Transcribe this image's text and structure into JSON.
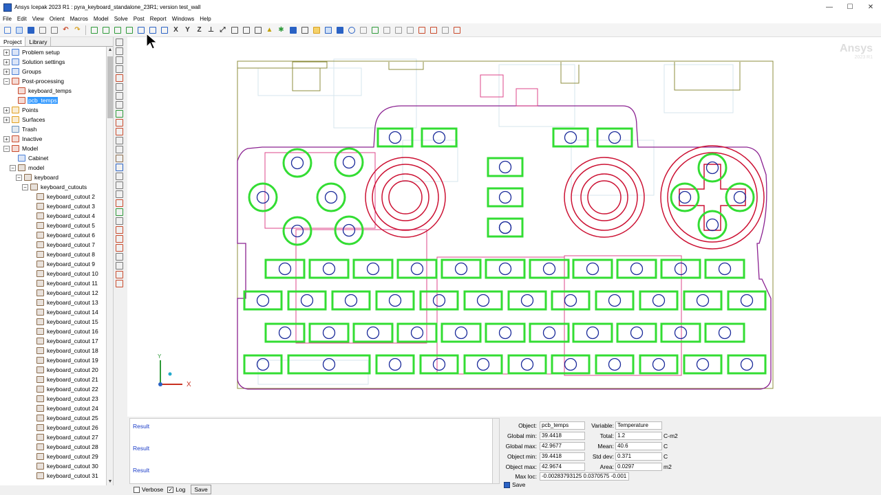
{
  "app": {
    "title": "Ansys Icepak 2023 R1 : pyra_keyboard_standalone_23R1; version test_wall"
  },
  "window_controls": {
    "minimize": "—",
    "maximize": "☐",
    "close": "✕"
  },
  "menu": [
    "File",
    "Edit",
    "View",
    "Orient",
    "Macros",
    "Model",
    "Solve",
    "Post",
    "Report",
    "Windows",
    "Help"
  ],
  "toolbar_axes": {
    "x": "X",
    "y": "Y",
    "z": "Z"
  },
  "project_tabs": [
    "Project",
    "Library"
  ],
  "tree": [
    {
      "label": "Problem setup",
      "level": 0,
      "expander": "+",
      "color": "#4a7fd6"
    },
    {
      "label": "Solution settings",
      "level": 0,
      "expander": "+",
      "color": "#4a7fd6"
    },
    {
      "label": "Groups",
      "level": 0,
      "expander": "+",
      "color": "#4a7fd6"
    },
    {
      "label": "Post-processing",
      "level": 0,
      "expander": "−",
      "color": "#c94a2c"
    },
    {
      "label": "keyboard_temps",
      "level": 1,
      "expander": "",
      "color": "#c94a2c"
    },
    {
      "label": "pcb_temps",
      "level": 1,
      "expander": "",
      "color": "#c94a2c",
      "selected": true
    },
    {
      "label": "Points",
      "level": 0,
      "expander": "+",
      "color": "#e0a020"
    },
    {
      "label": "Surfaces",
      "level": 0,
      "expander": "+",
      "color": "#e0a020"
    },
    {
      "label": "Trash",
      "level": 0,
      "expander": "",
      "color": "#6a8fb8"
    },
    {
      "label": "Inactive",
      "level": 0,
      "expander": "+",
      "color": "#c94a2c"
    },
    {
      "label": "Model",
      "level": 0,
      "expander": "−",
      "color": "#c94a2c"
    },
    {
      "label": "Cabinet",
      "level": 1,
      "expander": "",
      "color": "#4a7fd6"
    },
    {
      "label": "model",
      "level": 1,
      "expander": "−",
      "color": "#8a6a4a"
    },
    {
      "label": "keyboard",
      "level": 2,
      "expander": "−",
      "color": "#8a6a4a"
    },
    {
      "label": "keyboard_cutouts",
      "level": 3,
      "expander": "−",
      "color": "#8a6a4a"
    },
    {
      "label": "keyboard_cutout 2",
      "level": 4,
      "expander": "",
      "color": "#8a6a4a"
    },
    {
      "label": "keyboard_cutout 3",
      "level": 4,
      "expander": "",
      "color": "#8a6a4a"
    },
    {
      "label": "keyboard_cutout 4",
      "level": 4,
      "expander": "",
      "color": "#8a6a4a"
    },
    {
      "label": "keyboard_cutout 5",
      "level": 4,
      "expander": "",
      "color": "#8a6a4a"
    },
    {
      "label": "keyboard_cutout 6",
      "level": 4,
      "expander": "",
      "color": "#8a6a4a"
    },
    {
      "label": "keyboard_cutout 7",
      "level": 4,
      "expander": "",
      "color": "#8a6a4a"
    },
    {
      "label": "keyboard_cutout 8",
      "level": 4,
      "expander": "",
      "color": "#8a6a4a"
    },
    {
      "label": "keyboard_cutout 9",
      "level": 4,
      "expander": "",
      "color": "#8a6a4a"
    },
    {
      "label": "keyboard_cutout 10",
      "level": 4,
      "expander": "",
      "color": "#8a6a4a"
    },
    {
      "label": "keyboard_cutout 11",
      "level": 4,
      "expander": "",
      "color": "#8a6a4a"
    },
    {
      "label": "keyboard_cutout 12",
      "level": 4,
      "expander": "",
      "color": "#8a6a4a"
    },
    {
      "label": "keyboard_cutout 13",
      "level": 4,
      "expander": "",
      "color": "#8a6a4a"
    },
    {
      "label": "keyboard_cutout 14",
      "level": 4,
      "expander": "",
      "color": "#8a6a4a"
    },
    {
      "label": "keyboard_cutout 15",
      "level": 4,
      "expander": "",
      "color": "#8a6a4a"
    },
    {
      "label": "keyboard_cutout 16",
      "level": 4,
      "expander": "",
      "color": "#8a6a4a"
    },
    {
      "label": "keyboard_cutout 17",
      "level": 4,
      "expander": "",
      "color": "#8a6a4a"
    },
    {
      "label": "keyboard_cutout 18",
      "level": 4,
      "expander": "",
      "color": "#8a6a4a"
    },
    {
      "label": "keyboard_cutout 19",
      "level": 4,
      "expander": "",
      "color": "#8a6a4a"
    },
    {
      "label": "keyboard_cutout 20",
      "level": 4,
      "expander": "",
      "color": "#8a6a4a"
    },
    {
      "label": "keyboard_cutout 21",
      "level": 4,
      "expander": "",
      "color": "#8a6a4a"
    },
    {
      "label": "keyboard_cutout 22",
      "level": 4,
      "expander": "",
      "color": "#8a6a4a"
    },
    {
      "label": "keyboard_cutout 23",
      "level": 4,
      "expander": "",
      "color": "#8a6a4a"
    },
    {
      "label": "keyboard_cutout 24",
      "level": 4,
      "expander": "",
      "color": "#8a6a4a"
    },
    {
      "label": "keyboard_cutout 25",
      "level": 4,
      "expander": "",
      "color": "#8a6a4a"
    },
    {
      "label": "keyboard_cutout 26",
      "level": 4,
      "expander": "",
      "color": "#8a6a4a"
    },
    {
      "label": "keyboard_cutout 27",
      "level": 4,
      "expander": "",
      "color": "#8a6a4a"
    },
    {
      "label": "keyboard_cutout 28",
      "level": 4,
      "expander": "",
      "color": "#8a6a4a"
    },
    {
      "label": "keyboard_cutout 29",
      "level": 4,
      "expander": "",
      "color": "#8a6a4a"
    },
    {
      "label": "keyboard_cutout 30",
      "level": 4,
      "expander": "",
      "color": "#8a6a4a"
    },
    {
      "label": "keyboard_cutout 31",
      "level": 4,
      "expander": "",
      "color": "#8a6a4a"
    }
  ],
  "viewport": {
    "watermark": "Ansys",
    "watermark_version": "2023 R1",
    "axis_labels": {
      "x": "X",
      "y": "Y"
    },
    "colors": {
      "outline": "#8a2090",
      "key": "#33dd33",
      "ring": "#cc1133",
      "hole": "#1a2a9a",
      "pink": "#dd4488",
      "olive": "#8c8c3c"
    }
  },
  "messages": {
    "lines": [
      "Result",
      "Result",
      "Result"
    ],
    "verbose_label": "Verbose",
    "verbose_checked": false,
    "log_label": "Log",
    "log_checked": true,
    "save_label": "Save"
  },
  "stats": {
    "object_label": "Object:",
    "object_value": "pcb_temps",
    "variable_label": "Variable:",
    "variable_value": "Temperature",
    "global_min_label": "Global min:",
    "global_min_value": "39.4418",
    "global_max_label": "Global max:",
    "global_max_value": "42.9677",
    "object_min_label": "Object min:",
    "object_min_value": "39.4418",
    "object_max_label": "Object max:",
    "object_max_value": "42.9674",
    "max_loc_label": "Max loc:",
    "max_loc_value": "-0.00283793125 0.0370575 -0.001",
    "total_label": "Total:",
    "total_value": "1.2",
    "total_unit": "C-m2",
    "mean_label": "Mean:",
    "mean_value": "40.6",
    "mean_unit": "C",
    "std_label": "Std dev:",
    "std_value": "0.371",
    "std_unit": "C",
    "area_label": "Area:",
    "area_value": "0.0297",
    "area_unit": "m2",
    "save_label": "Save"
  }
}
